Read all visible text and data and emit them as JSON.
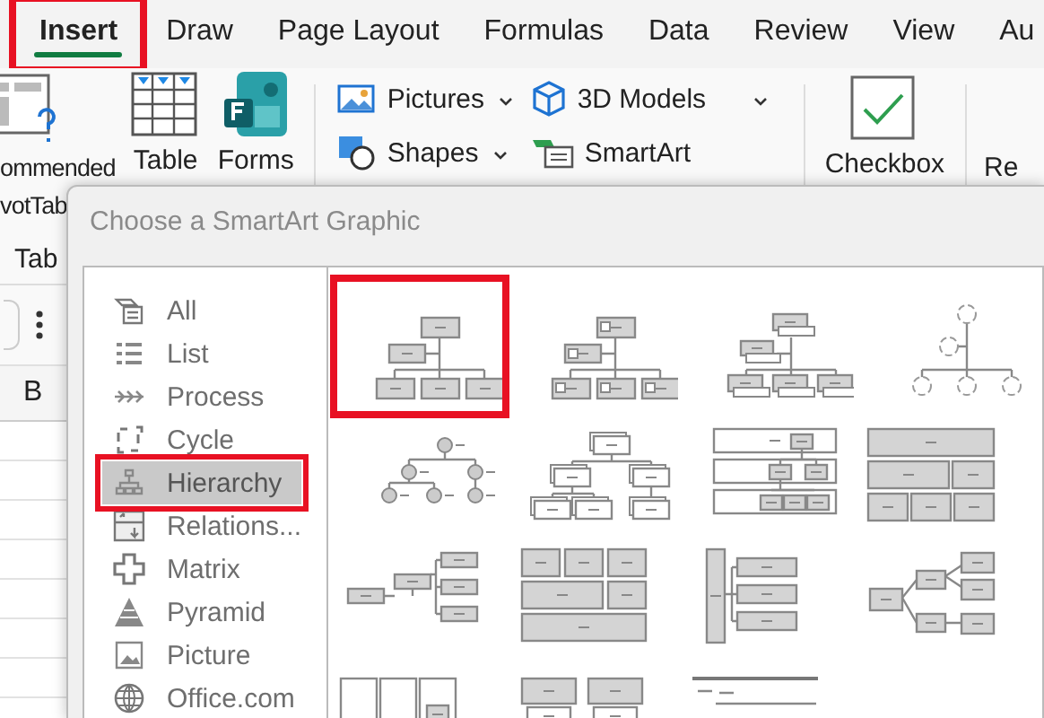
{
  "ribbon_tabs": [
    {
      "label": "Insert",
      "selected": true,
      "highlighted": true
    },
    {
      "label": "Draw",
      "selected": false,
      "highlighted": false
    },
    {
      "label": "Page Layout",
      "selected": false,
      "highlighted": false
    },
    {
      "label": "Formulas",
      "selected": false,
      "highlighted": false
    },
    {
      "label": "Data",
      "selected": false,
      "highlighted": false
    },
    {
      "label": "Review",
      "selected": false,
      "highlighted": false
    },
    {
      "label": "View",
      "selected": false,
      "highlighted": false
    },
    {
      "label": "Au",
      "selected": false,
      "highlighted": false
    }
  ],
  "ribbon": {
    "large_buttons": [
      {
        "kind": "pivot",
        "lines": [
          "ommended",
          "votTab"
        ]
      },
      {
        "kind": "table",
        "lines": [
          "Table"
        ]
      },
      {
        "kind": "forms",
        "lines": [
          "Forms"
        ]
      }
    ],
    "small_buttons": [
      {
        "kind": "pictures",
        "label": "Pictures",
        "dropdown": true
      },
      {
        "kind": "models",
        "label": "3D Models",
        "dropdown": true
      },
      {
        "kind": "shapes",
        "label": "Shapes",
        "dropdown": true
      },
      {
        "kind": "smartart",
        "label": "SmartArt",
        "dropdown": false
      }
    ],
    "checkbox_button": {
      "label": "Checkbox"
    },
    "cut_button": {
      "label": "Re"
    },
    "group_label": "Tab"
  },
  "sheet": {
    "column_header": "B"
  },
  "dialog": {
    "title": "Choose a SmartArt Graphic",
    "categories": [
      {
        "label": "All",
        "selected": false,
        "highlighted": false
      },
      {
        "label": "List",
        "selected": false,
        "highlighted": false
      },
      {
        "label": "Process",
        "selected": false,
        "highlighted": false
      },
      {
        "label": "Cycle",
        "selected": false,
        "highlighted": false
      },
      {
        "label": "Hierarchy",
        "selected": true,
        "highlighted": true
      },
      {
        "label": "Relations...",
        "selected": false,
        "highlighted": false
      },
      {
        "label": "Matrix",
        "selected": false,
        "highlighted": false
      },
      {
        "label": "Pyramid",
        "selected": false,
        "highlighted": false
      },
      {
        "label": "Picture",
        "selected": false,
        "highlighted": false
      },
      {
        "label": "Office.com",
        "selected": false,
        "highlighted": false
      }
    ],
    "layouts": [
      {
        "kind": "org",
        "selected": false,
        "highlighted": true
      },
      {
        "kind": "picture-org",
        "selected": false,
        "highlighted": false
      },
      {
        "kind": "name-title",
        "selected": false,
        "highlighted": false
      },
      {
        "kind": "circle-org",
        "selected": false,
        "highlighted": false
      },
      {
        "kind": "labeled-circles",
        "selected": false,
        "highlighted": false
      },
      {
        "kind": "stacked",
        "selected": false,
        "highlighted": false
      },
      {
        "kind": "labeled-bands",
        "selected": false,
        "highlighted": false
      },
      {
        "kind": "table-blocks",
        "selected": false,
        "highlighted": false
      },
      {
        "kind": "horizontal-org",
        "selected": false,
        "highlighted": false
      },
      {
        "kind": "architecture",
        "selected": false,
        "highlighted": false
      },
      {
        "kind": "vertical-bar",
        "selected": false,
        "highlighted": false
      },
      {
        "kind": "horizontal-tree",
        "selected": false,
        "highlighted": false
      },
      {
        "kind": "columns",
        "selected": false,
        "highlighted": false
      },
      {
        "kind": "paired-boxes",
        "selected": false,
        "highlighted": false
      },
      {
        "kind": "lines",
        "selected": false,
        "highlighted": false
      }
    ]
  }
}
